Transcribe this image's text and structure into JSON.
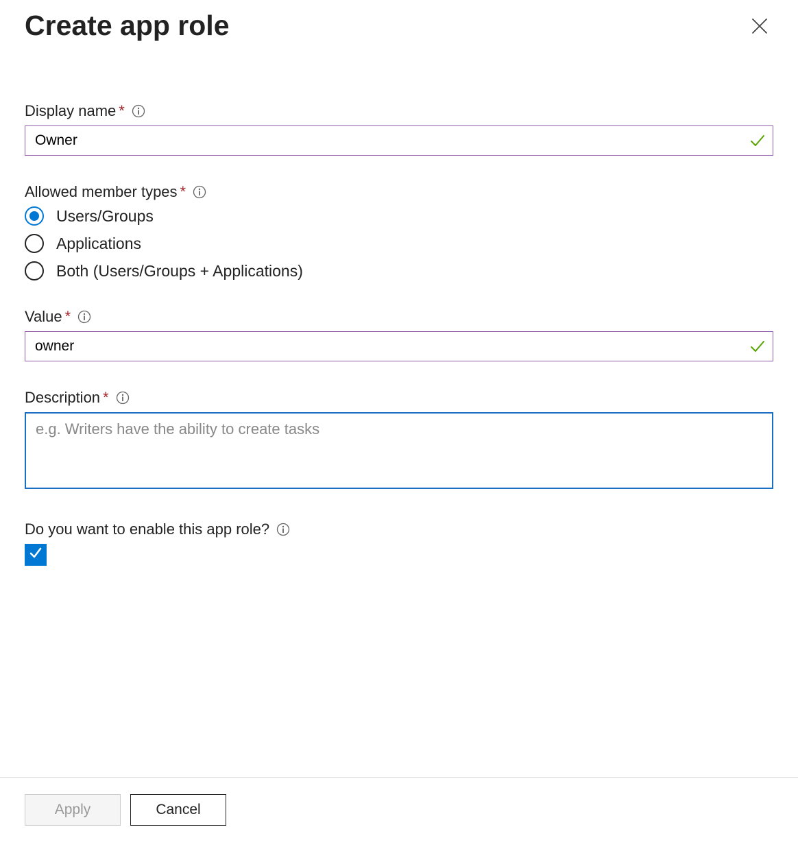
{
  "header": {
    "title": "Create app role"
  },
  "fields": {
    "display_name": {
      "label": "Display name",
      "value": "Owner"
    },
    "allowed_types": {
      "label": "Allowed member types",
      "options": {
        "users_groups": "Users/Groups",
        "applications": "Applications",
        "both": "Both (Users/Groups + Applications)"
      },
      "selected": "users_groups"
    },
    "value_field": {
      "label": "Value",
      "value": "owner"
    },
    "description": {
      "label": "Description",
      "placeholder": "e.g. Writers have the ability to create tasks",
      "value": ""
    },
    "enable": {
      "label": "Do you want to enable this app role?",
      "checked": true
    }
  },
  "footer": {
    "apply": "Apply",
    "cancel": "Cancel"
  }
}
